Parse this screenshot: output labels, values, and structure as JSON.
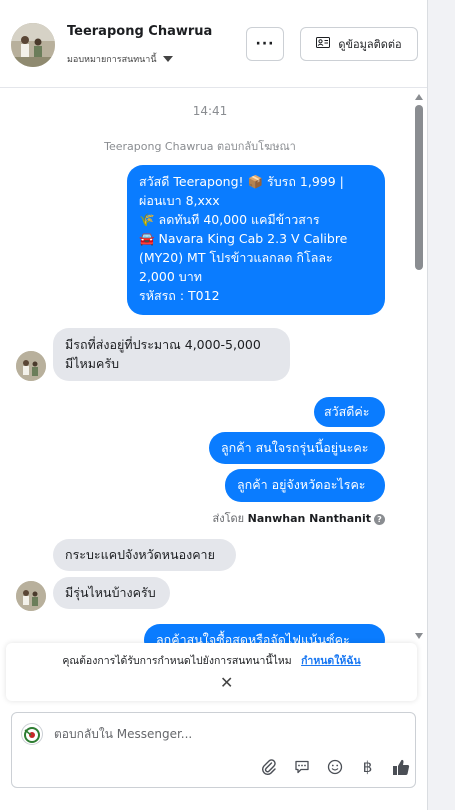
{
  "header": {
    "contact_name": "Teerapong Chawrua",
    "assign_label": "มอบหมายการสนทนานี้",
    "more_label": "···",
    "contact_info_label": "ดูข้อมูลติดต่อ"
  },
  "chat": {
    "timestamp": "14:41",
    "ad_reply_note": "Teerapong Chawrua ตอบกลับโฆษณา",
    "ad_message": {
      "line1": "สวัสดี Teerapong! 📦 รับรถ 1,999 |",
      "line2": "ผ่อนเบา 8,xxx",
      "line3": "🌾 ลดทันที 40,000 แคมีข้าวสาร",
      "line4": "🚘 Navara King Cab 2.3 V Calibre",
      "line5": "(MY20) MT โปรข้าวแลกลด กิโลละ",
      "line6": "2,000 บาท",
      "line7": "รหัสรถ : T012"
    },
    "incoming_1": {
      "line1": "มีรถที่ส่งอยู่ที่ประมาณ 4,000-5,000",
      "line2": "มีไหมครับ"
    },
    "outgoing_1": "สวัสดีค่ะ",
    "outgoing_2": "ลูกค้า สนใจรถรุ่นนี้อยู่นะคะ",
    "outgoing_3": "ลูกค้า อยู่จังหวัดอะไรคะ",
    "sent_by_prefix": "ส่งโดย",
    "sent_by_name": "Nanwhan Nanthanit",
    "incoming_2": "กระบะแคปจังหวัดหนองคาย",
    "incoming_3": "มีรุ่นไหนบ้างครับ",
    "outgoing_4": "ลูกค้าสนใจซื้อสดหรือจัดไฟแน้นซ์คะ"
  },
  "notification": {
    "text": "คุณต้องการได้รับการกำหนดไปยังการสนทนานี้ไหม",
    "link": "กำหนดให้ฉัน",
    "close": "✕"
  },
  "composer": {
    "placeholder": "ตอบกลับใน Messenger..."
  },
  "tools": {
    "attach": "attach-icon",
    "saved_replies": "chat-bubble-icon",
    "emoji": "emoji-icon",
    "payment": "฿",
    "like": "thumbs-up-icon"
  },
  "colors": {
    "outgoing_bubble": "#0a7cff",
    "incoming_bubble": "#e4e6eb",
    "link": "#1877f2"
  }
}
